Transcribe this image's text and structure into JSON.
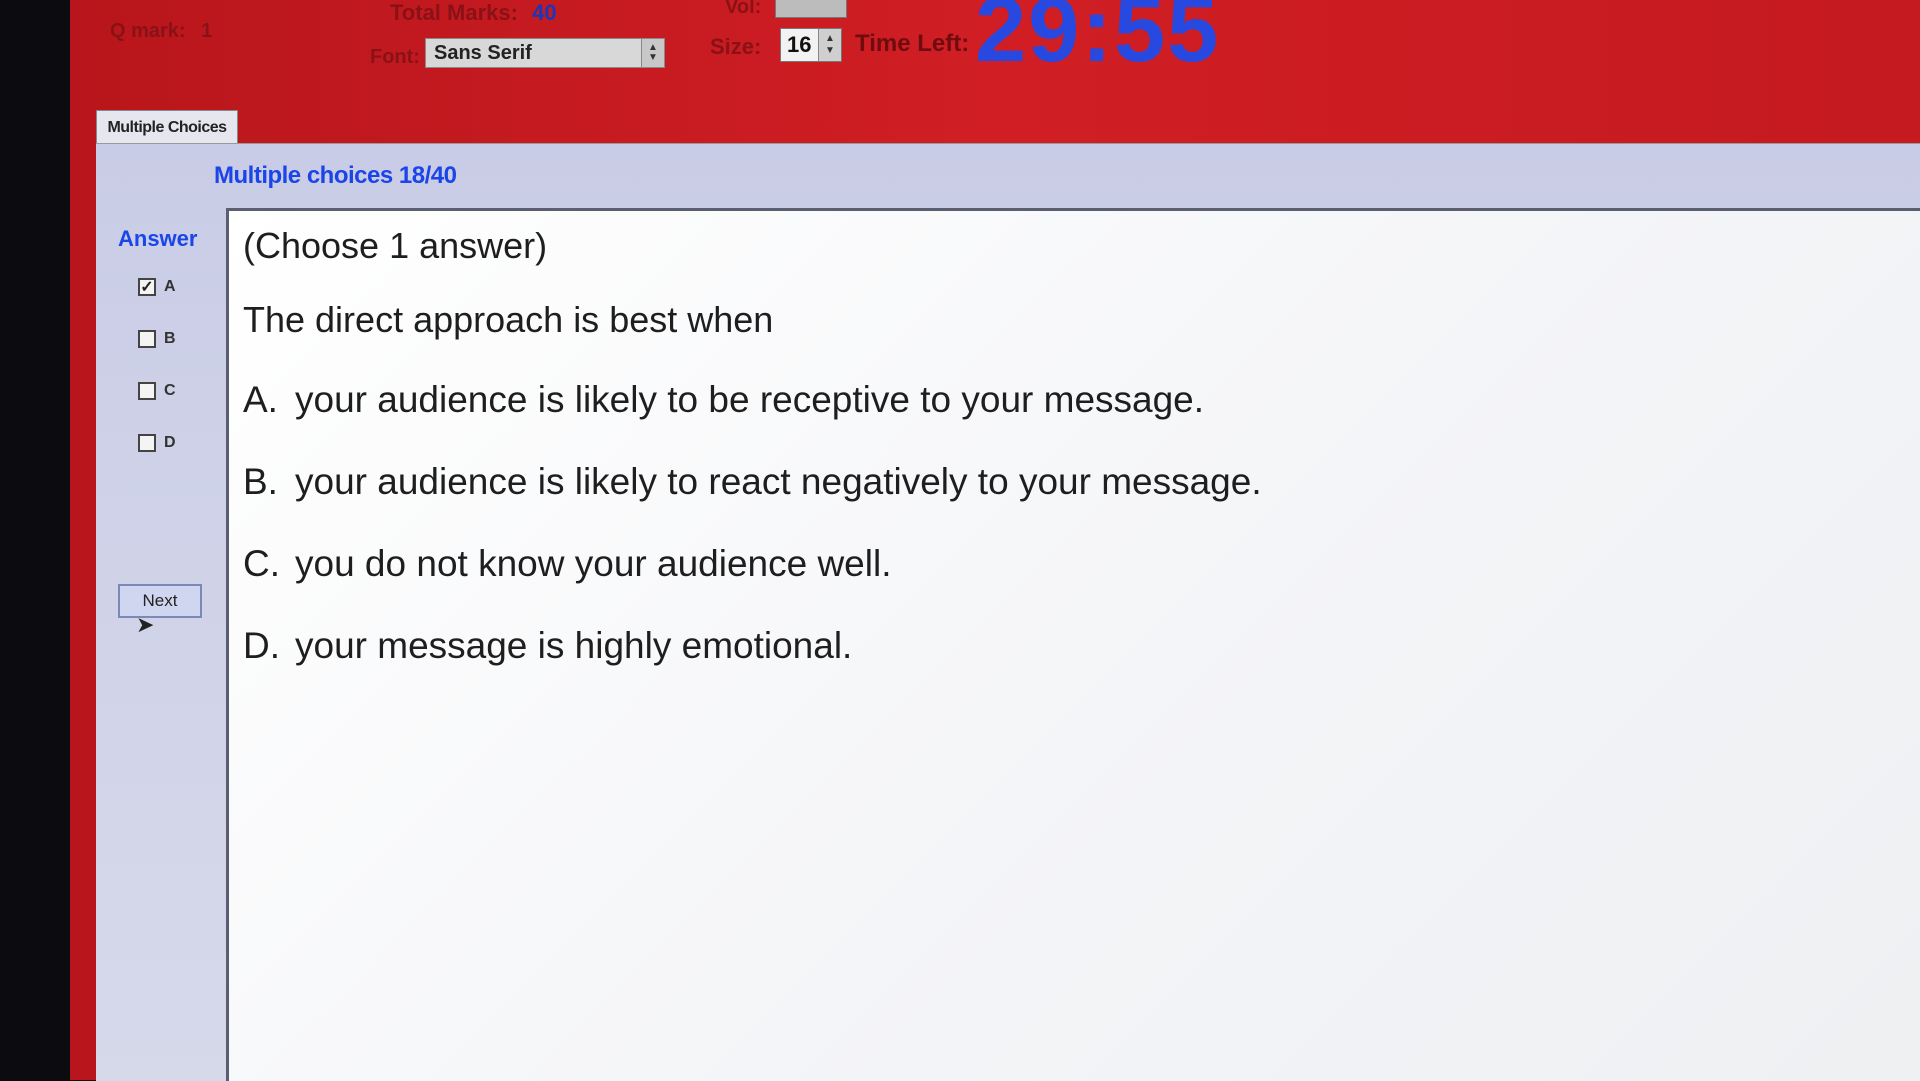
{
  "header": {
    "qmark_label": "Q mark:",
    "qmark_value": "1",
    "total_marks_label": "Total Marks:",
    "total_marks_value": "40",
    "vol_label": "Vol:",
    "font_label": "Font:",
    "font_value": "Sans Serif",
    "size_label": "Size:",
    "size_value": "16",
    "time_left_label": "Time Left:",
    "time_left_value": "29:55"
  },
  "tab": {
    "label": "Multiple Choices"
  },
  "section": {
    "title": "Multiple choices 18/40"
  },
  "answer": {
    "label": "Answer",
    "options": [
      {
        "letter": "A",
        "checked": true
      },
      {
        "letter": "B",
        "checked": false
      },
      {
        "letter": "C",
        "checked": false
      },
      {
        "letter": "D",
        "checked": false
      }
    ],
    "next_label": "Next"
  },
  "question": {
    "instruction": "(Choose 1 answer)",
    "text": "The direct approach is best when",
    "options": [
      {
        "letter": "A.",
        "text": "your audience is likely to be receptive to your message."
      },
      {
        "letter": "B.",
        "text": "your audience is likely to react negatively to your message."
      },
      {
        "letter": "C.",
        "text": "you do not know your audience well."
      },
      {
        "letter": "D.",
        "text": "your message is highly emotional."
      }
    ]
  },
  "colors": {
    "frame_red": "#c41a20",
    "timer_blue": "#2849e0",
    "label_blue": "#1a45e8",
    "panel_bg": "#cfd2e8"
  }
}
